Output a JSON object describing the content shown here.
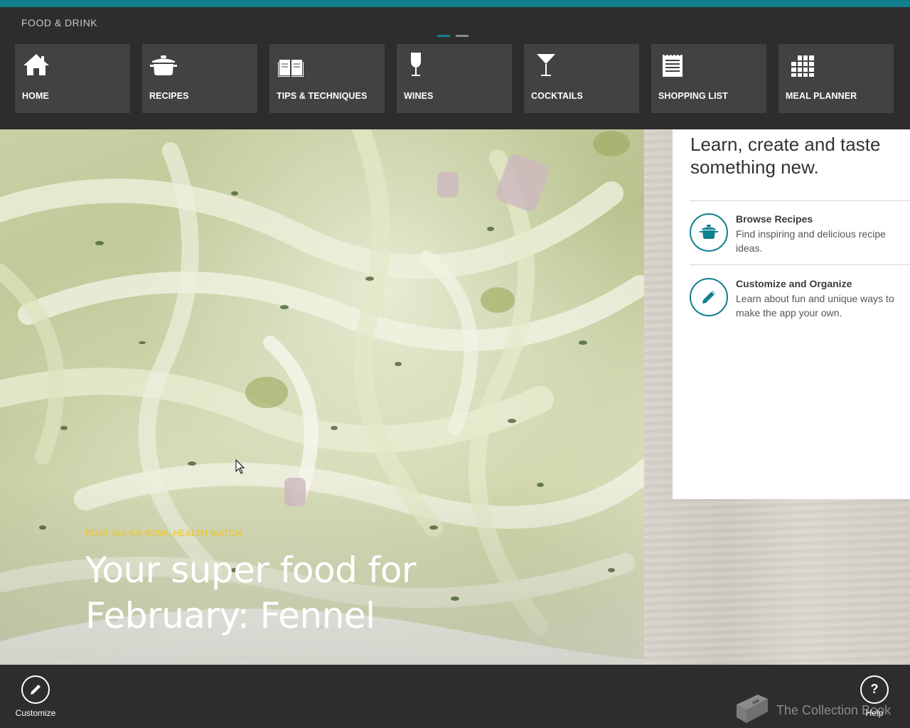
{
  "app": {
    "title": "FOOD & DRINK",
    "accent_color": "#107f8e",
    "page_indicator": {
      "total": 2,
      "current": 1
    }
  },
  "nav": {
    "tiles": [
      {
        "label": "HOME",
        "icon": "home-icon"
      },
      {
        "label": "RECIPES",
        "icon": "pot-icon"
      },
      {
        "label": "TIPS & TECHNIQUES",
        "icon": "open-book-icon"
      },
      {
        "label": "WINES",
        "icon": "wine-glass-icon"
      },
      {
        "label": "COCKTAILS",
        "icon": "cocktail-glass-icon"
      },
      {
        "label": "SHOPPING LIST",
        "icon": "list-pad-icon"
      },
      {
        "label": "MEAL PLANNER",
        "icon": "grid-calendar-icon"
      }
    ]
  },
  "hero": {
    "kicker": "POST-SUPER BOWL HEALTH WATCH",
    "kicker_color": "#f2c21b",
    "headline": "Your super food for February: Fennel"
  },
  "panel": {
    "heading": "Learn, create and taste something new.",
    "items": [
      {
        "title": "Browse Recipes",
        "description": "Find inspiring and delicious recipe ideas.",
        "icon": "pot-icon"
      },
      {
        "title": "Customize and Organize",
        "description": "Learn about fun and unique ways to make the app your own.",
        "icon": "pencil-icon"
      }
    ]
  },
  "appbar": {
    "customize_label": "Customize",
    "help_label": "Help",
    "help_glyph": "?",
    "collection_book_label": "The Collection Book"
  }
}
